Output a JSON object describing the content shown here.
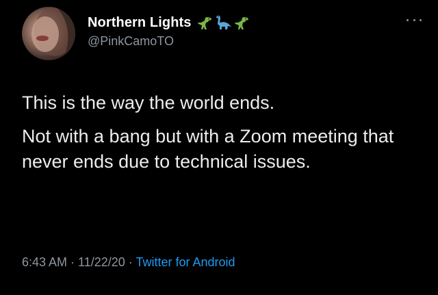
{
  "tweet": {
    "display_name": "Northern Lights",
    "handle": "@PinkCamoTO",
    "name_emojis": [
      "t-rex-icon",
      "sauropod-icon",
      "t-rex-icon"
    ],
    "paragraphs": [
      "This is the way the world ends.",
      "Not with a bang but with a Zoom meeting that never ends due to technical issues."
    ],
    "time": "6:43 AM",
    "separator": " · ",
    "date": "11/22/20",
    "source": "Twitter for Android"
  },
  "colors": {
    "background": "#000000",
    "text": "#ededed",
    "secondary": "#8e979f",
    "link": "#1d9bf0",
    "dino": "#7ab648"
  }
}
